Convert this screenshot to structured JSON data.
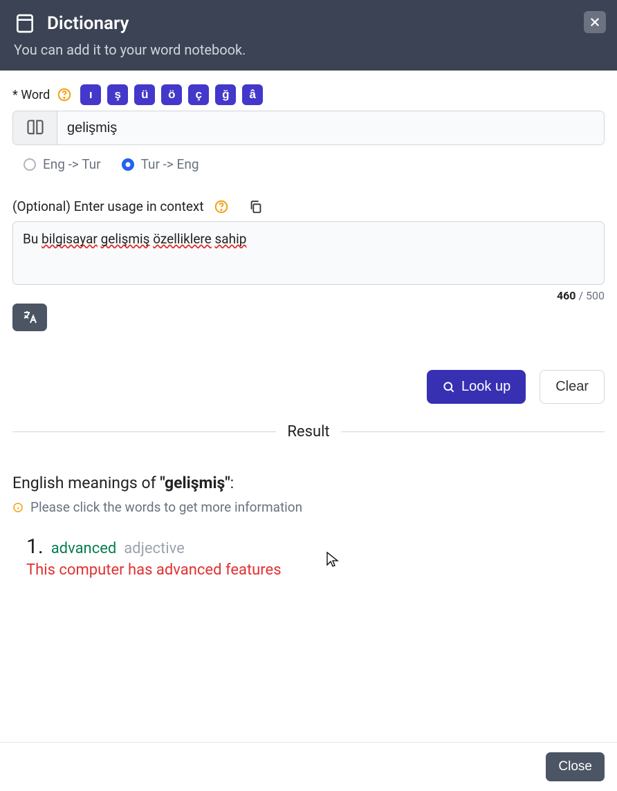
{
  "header": {
    "title": "Dictionary",
    "subtitle": "You can add it to your word notebook."
  },
  "word_section": {
    "label": "* Word",
    "characters": [
      "ı",
      "ş",
      "ü",
      "ö",
      "ç",
      "ğ",
      "â"
    ],
    "input_value": "gelişmiş"
  },
  "direction": {
    "options": [
      {
        "label": "Eng -> Tur",
        "checked": false
      },
      {
        "label": "Tur -> Eng",
        "checked": true
      }
    ]
  },
  "context": {
    "label": "(Optional) Enter usage in context",
    "value_parts": [
      {
        "text": "Bu ",
        "underline": false
      },
      {
        "text": "bilgisayar",
        "underline": true
      },
      {
        "text": " ",
        "underline": false
      },
      {
        "text": "gelişmiş",
        "underline": true
      },
      {
        "text": " ",
        "underline": false
      },
      {
        "text": "özelliklere",
        "underline": true
      },
      {
        "text": " ",
        "underline": false
      },
      {
        "text": "sahip",
        "underline": true
      }
    ],
    "count_current": "460",
    "count_max": " / 500"
  },
  "actions": {
    "lookup": "Look up",
    "clear": "Clear"
  },
  "result": {
    "separator_label": "Result",
    "heading_prefix": "English meanings of ",
    "heading_word": "\"gelişmiş\"",
    "heading_suffix": ":",
    "hint": "Please click the words to get more information",
    "definition": {
      "number": "1.",
      "word": "advanced",
      "part_of_speech": "adjective",
      "sentence": "This computer has advanced features"
    }
  },
  "footer": {
    "close": "Close"
  }
}
